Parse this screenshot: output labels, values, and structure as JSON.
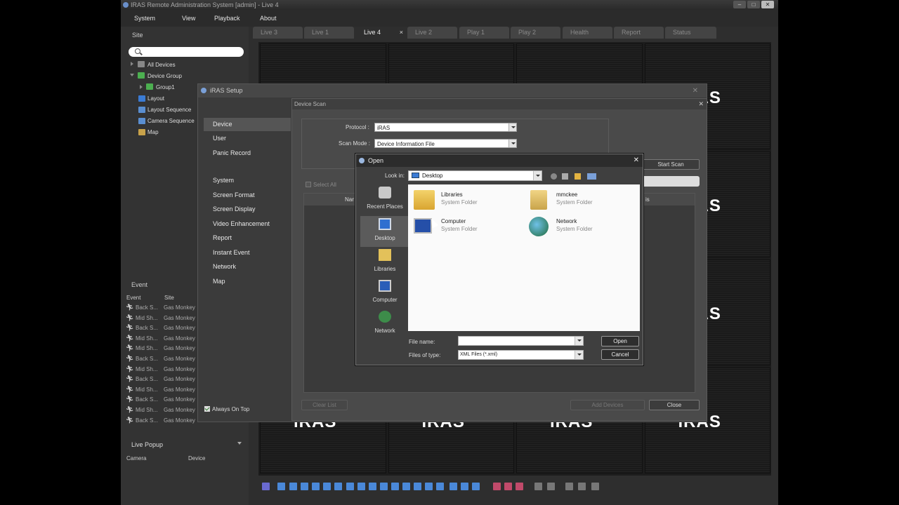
{
  "window": {
    "title": "IRAS Remote Administration System [admin] - Live 4"
  },
  "menu": [
    "System",
    "View",
    "Playback",
    "About"
  ],
  "tabs": [
    {
      "label": "Live 3"
    },
    {
      "label": "Live 1"
    },
    {
      "label": "Live 4",
      "active": true,
      "close": "×"
    },
    {
      "label": "Live 2"
    },
    {
      "label": "Play 1"
    },
    {
      "label": "Play 2"
    },
    {
      "label": "Health"
    },
    {
      "label": "Report"
    },
    {
      "label": "Status"
    }
  ],
  "site": {
    "header": "Site",
    "tree": [
      "All Devices",
      "Device Group",
      "Group1",
      "Layout",
      "Layout Sequence",
      "Camera Sequence",
      "Map"
    ]
  },
  "event": {
    "header": "Event",
    "columns": [
      "Event",
      "Site"
    ],
    "rows": [
      {
        "event": "Back S...",
        "site": "Gas Monkey"
      },
      {
        "event": "Mid Sh...",
        "site": "Gas Monkey"
      },
      {
        "event": "Back S...",
        "site": "Gas Monkey"
      },
      {
        "event": "Mid Sh...",
        "site": "Gas Monkey"
      },
      {
        "event": "Mid Sh...",
        "site": "Gas Monkey"
      },
      {
        "event": "Back S...",
        "site": "Gas Monkey"
      },
      {
        "event": "Mid Sh...",
        "site": "Gas Monkey"
      },
      {
        "event": "Back S...",
        "site": "Gas Monkey"
      },
      {
        "event": "Mid Sh...",
        "site": "Gas Monkey"
      },
      {
        "event": "Back S...",
        "site": "Gas Monkey"
      },
      {
        "event": "Mid Sh...",
        "site": "Gas Monkey"
      },
      {
        "event": "Back S...",
        "site": "Gas Monkey"
      }
    ]
  },
  "live_popup": {
    "header": "Live Popup",
    "columns": [
      "Camera",
      "Device"
    ]
  },
  "video_logo": "iRAS",
  "setup": {
    "title": "iRAS Setup",
    "nav_group1": [
      "Device",
      "User",
      "Panic Record"
    ],
    "nav_group2": [
      "System",
      "Screen Format",
      "Screen Display",
      "Video Enhancement",
      "Report",
      "Instant Event",
      "Network",
      "Map"
    ],
    "always_on_top": "Always On Top"
  },
  "scan": {
    "title": "Device Scan",
    "protocol_label": "Protocol :",
    "protocol_value": "iRAS",
    "scan_mode_label": "Scan Mode :",
    "scan_mode_value": "Device Information File",
    "start_scan": "Start Scan",
    "select_all": "Select All",
    "col_name": "Nar",
    "col_status": "is",
    "clear_list": "Clear List",
    "add_devices": "Add Devices",
    "close": "Close"
  },
  "open_dialog": {
    "title": "Open",
    "look_in_label": "Look in:",
    "look_in_value": "Desktop",
    "places": [
      "Recent Places",
      "Desktop",
      "Libraries",
      "Computer",
      "Network"
    ],
    "files": [
      {
        "name": "Libraries",
        "type": "System Folder"
      },
      {
        "name": "mmckee",
        "type": "System Folder"
      },
      {
        "name": "Computer",
        "type": "System Folder"
      },
      {
        "name": "Network",
        "type": "System Folder"
      }
    ],
    "file_name_label": "File name:",
    "file_name_value": "",
    "file_type_label": "Files of type:",
    "file_type_value": "XML Files (*.xml)",
    "open_button": "Open",
    "cancel_button": "Cancel"
  }
}
